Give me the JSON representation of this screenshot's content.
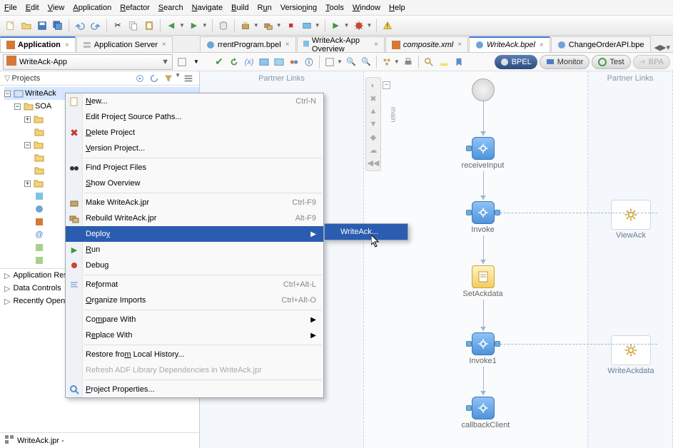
{
  "menus": [
    "File",
    "Edit",
    "View",
    "Application",
    "Refactor",
    "Search",
    "Navigate",
    "Build",
    "Run",
    "Versioning",
    "Tools",
    "Window",
    "Help"
  ],
  "doctabs_left": [
    {
      "label": "Application",
      "active": true,
      "icon": "app"
    },
    {
      "label": "Application Server",
      "active": false,
      "icon": "server"
    }
  ],
  "doctabs_right": [
    {
      "label": "rrentProgram.bpel",
      "icon": "bpel",
      "italic": false
    },
    {
      "label": "WriteAck-App Overview",
      "icon": "overview"
    },
    {
      "label": "composite.xml",
      "icon": "xml",
      "italic": true
    },
    {
      "label": "WriteAck.bpel",
      "icon": "bpel",
      "active": true,
      "italic": true
    },
    {
      "label": "ChangeOrderAPI.bpe",
      "icon": "bpel"
    }
  ],
  "app_combo": "WriteAck-App",
  "projects_title": "Projects",
  "tree_root": "WriteAck",
  "tree_child": "SOA",
  "left_sections": [
    "Application Res",
    "Data Controls",
    "Recently Open"
  ],
  "selected_file": "WriteAck.jpr -",
  "partner_links_label": "Partner Links",
  "main_label": "main",
  "nodes": {
    "receive": "receiveInput",
    "invoke": "Invoke",
    "setack": "SetAckdata",
    "invoke1": "Invoke1",
    "callback": "callbackClient"
  },
  "pl_right": {
    "viewack": "ViewAck",
    "writeack": "WriteAckdata"
  },
  "pills": {
    "bpel": "BPEL",
    "monitor": "Monitor",
    "test": "Test",
    "bpa": "BPA"
  },
  "ctx": {
    "new": "New...",
    "edit_src": "Edit Project Source Paths...",
    "delete": "Delete Project",
    "version": "Version Project...",
    "find": "Find Project Files",
    "show": "Show Overview",
    "make": "Make WriteAck.jpr",
    "rebuild": "Rebuild WriteAck.jpr",
    "deploy": "Deploy",
    "run": "Run",
    "debug": "Debug",
    "reformat": "Reformat",
    "org_imp": "Organize Imports",
    "compare": "Compare With",
    "replace": "Replace With",
    "restore": "Restore from Local History...",
    "refresh": "Refresh ADF Library Dependencies in WriteAck.jpr",
    "props": "Project Properties...",
    "sc_new": "Ctrl-N",
    "sc_make": "Ctrl-F9",
    "sc_rebuild": "Alt-F9",
    "sc_reformat": "Ctrl+Alt-L",
    "sc_org": "Ctrl+Alt-O"
  },
  "submenu_item": "WriteAck..."
}
